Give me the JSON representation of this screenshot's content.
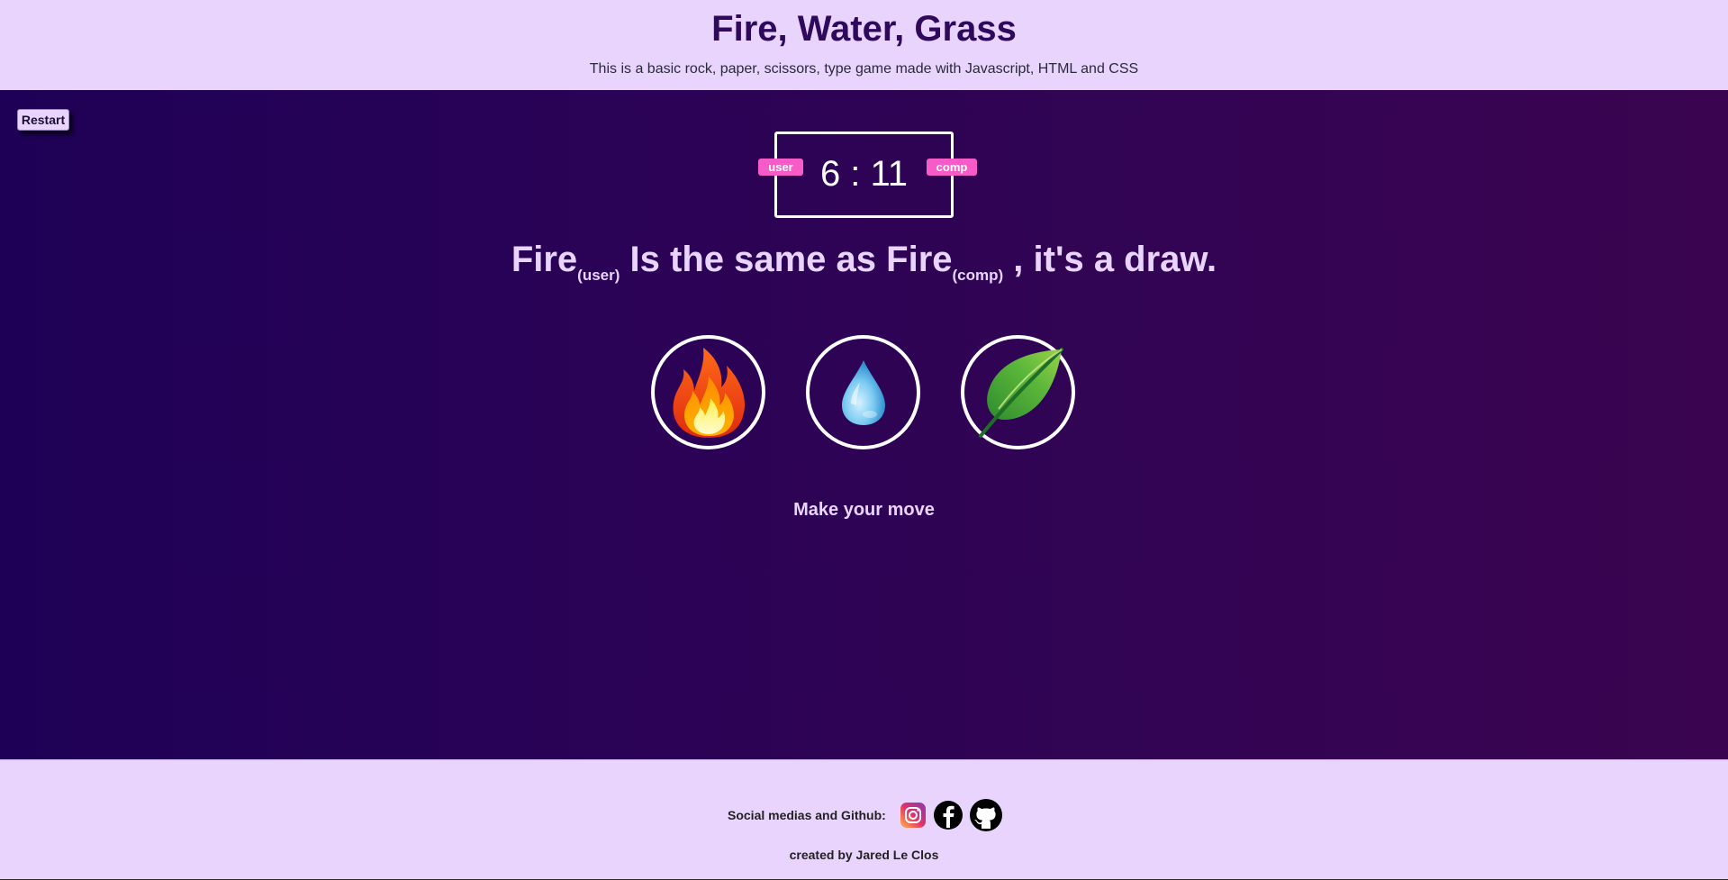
{
  "header": {
    "title": "Fire, Water, Grass",
    "subtitle": "This is a basic rock, paper, scissors, type game made with Javascript, HTML and CSS"
  },
  "game": {
    "restart_label": "Restart",
    "score": "6 : 11",
    "user_badge": "user",
    "comp_badge": "comp",
    "result": {
      "user_choice": "Fire",
      "user_sub": "(user)",
      "middle": " Is the same as ",
      "comp_choice": "Fire",
      "comp_sub": "(comp)",
      "end": " , it's a draw."
    },
    "choices": [
      {
        "name": "Fire",
        "icon": "fire-icon"
      },
      {
        "name": "Water",
        "icon": "water-drop-icon"
      },
      {
        "name": "Grass",
        "icon": "leaf-icon"
      }
    ],
    "prompt": "Make your move"
  },
  "footer": {
    "social_label": "Social medias and Github:",
    "icons": [
      "instagram-icon",
      "facebook-icon",
      "github-icon"
    ],
    "credit": "created by Jared Le Clos"
  },
  "colors": {
    "accent_pink": "#f65bc8",
    "panel_lilac": "#e8d4fd",
    "title_purple": "#2f0a5c"
  }
}
